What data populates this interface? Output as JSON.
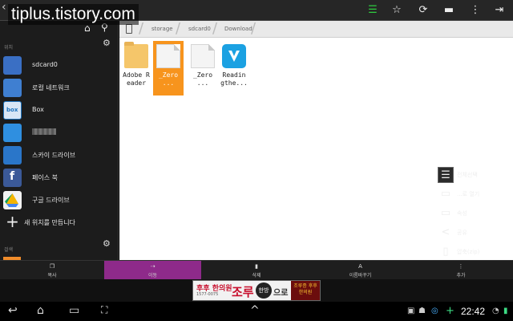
{
  "watermark": "tiplus.tistory.com",
  "topbar": {
    "actions": [
      "list-view-icon",
      "star-icon",
      "refresh-icon",
      "new-folder-icon",
      "overflow-menu-icon"
    ]
  },
  "sidebar": {
    "section_locations": "위치",
    "section_bookmarks": "걸색",
    "items": [
      {
        "label": "sdcard0",
        "icon": "sdcard-icon",
        "color": "#3a6fc4"
      },
      {
        "label": "로컬 네트워크",
        "icon": "network-icon",
        "color": "#3f7fd1"
      },
      {
        "label": "Box",
        "icon": "box-icon",
        "color": "#1e73be"
      },
      {
        "label": "",
        "icon": "dropbox-icon",
        "color": "#2f8fe0"
      },
      {
        "label": "스카이 드라이브",
        "icon": "skydrive-icon",
        "color": "#2a76c9"
      },
      {
        "label": "페이스 북",
        "icon": "facebook-icon",
        "color": "#3b5998"
      },
      {
        "label": "구글 드라이브",
        "icon": "google-drive-icon",
        "color": "#f2f2f2"
      },
      {
        "label": "새 위치를 만듭니다",
        "icon": "plus-icon",
        "color": "#1c1c1c"
      }
    ]
  },
  "breadcrumb": [
    "storage",
    "sdcard0",
    "Download"
  ],
  "files": [
    {
      "name": "Adobe Reader",
      "type": "folder",
      "selected": false
    },
    {
      "name": "_Zero ...",
      "type": "document",
      "selected": true
    },
    {
      "name": "_Zero ...",
      "type": "document",
      "selected": false
    },
    {
      "name": "Readin gthe...",
      "type": "app",
      "selected": false
    }
  ],
  "context_menu": [
    {
      "label": "전체선택",
      "icon": "select-all-icon"
    },
    {
      "label": "...로 열기",
      "icon": "open-with-icon"
    },
    {
      "label": "속성",
      "icon": "properties-icon"
    },
    {
      "label": "공유",
      "icon": "share-icon"
    },
    {
      "label": "압축(zip)",
      "icon": "zip-icon"
    }
  ],
  "toolbar": [
    {
      "label": "복사",
      "icon": "copy-icon",
      "active": false
    },
    {
      "label": "이동",
      "icon": "move-icon",
      "active": true
    },
    {
      "label": "삭제",
      "icon": "delete-icon",
      "active": false
    },
    {
      "label": "이름바꾸기",
      "icon": "rename-icon",
      "active": false
    },
    {
      "label": "추가",
      "icon": "more-icon",
      "active": false
    }
  ],
  "ad": {
    "brand_left": "후후 한의원",
    "phone": "1577-0075",
    "main": "조루",
    "badge": "한방",
    "suffix": "으로",
    "brand_right": "조루증 후후 한의원"
  },
  "statusbar": {
    "time": "22:42"
  },
  "colors": {
    "accent_active": "#8e2a8a",
    "selection": "#f7941d"
  }
}
